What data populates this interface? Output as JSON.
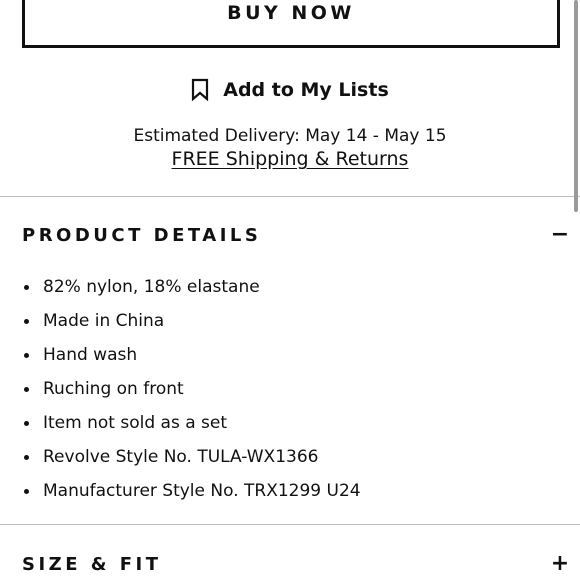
{
  "buy_button": {
    "label": "BUY NOW"
  },
  "add_to_lists": {
    "label": "Add to My Lists",
    "icon": "bookmark-icon"
  },
  "delivery": {
    "text": "Estimated Delivery: May 14 - May 15"
  },
  "shipping": {
    "link_text": "FREE Shipping & Returns"
  },
  "product_details": {
    "title": "PRODUCT DETAILS",
    "toggle": "−",
    "items": [
      "82% nylon, 18% elastane",
      "Made in China",
      "Hand wash",
      "Ruching on front",
      "Item not sold as a set",
      "Revolve Style No. TULA-WX1366",
      "Manufacturer Style No. TRX1299 U24"
    ]
  },
  "size_fit": {
    "title": "SIZE & FIT",
    "toggle": "+"
  }
}
